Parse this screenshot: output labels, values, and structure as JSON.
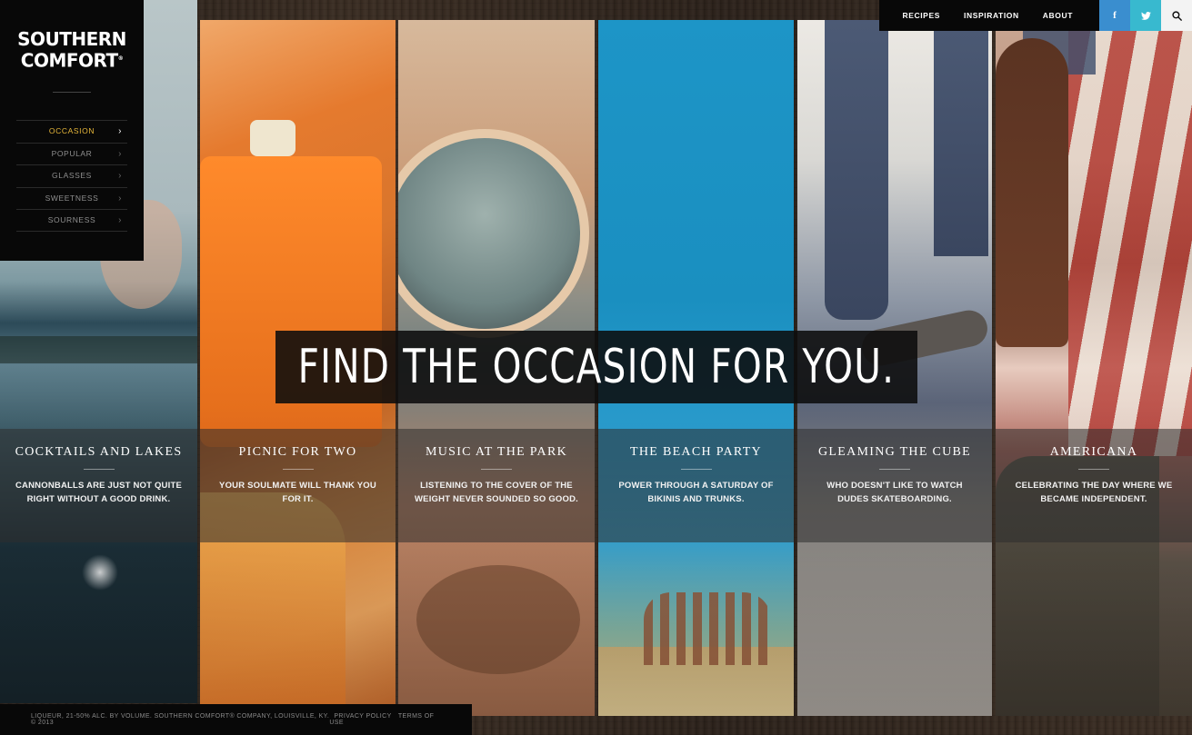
{
  "brand": {
    "line1": "SOUTHERN",
    "line2": "COMFORT",
    "reg": "®"
  },
  "sidebar": {
    "items": [
      {
        "label": "OCCASION",
        "active": true
      },
      {
        "label": "POPULAR",
        "active": false
      },
      {
        "label": "GLASSES",
        "active": false
      },
      {
        "label": "SWEETNESS",
        "active": false
      },
      {
        "label": "SOURNESS",
        "active": false
      }
    ],
    "chevron": "›"
  },
  "topnav": {
    "links": [
      "RECIPES",
      "INSPIRATION",
      "ABOUT"
    ],
    "facebook_icon": "f",
    "twitter_icon": "twitter-bird",
    "search_icon": "magnifier"
  },
  "headline": "FIND THE OCCASION FOR YOU.",
  "occasions": [
    {
      "title": "COCKTAILS AND LAKES",
      "desc": "CANNONBALLS ARE JUST NOT QUITE RIGHT WITHOUT A GOOD DRINK."
    },
    {
      "title": "PICNIC FOR TWO",
      "desc": "YOUR SOULMATE WILL THANK YOU FOR IT."
    },
    {
      "title": "MUSIC AT THE PARK",
      "desc": "LISTENING TO THE COVER OF THE WEIGHT NEVER SOUNDED SO GOOD."
    },
    {
      "title": "THE BEACH PARTY",
      "desc": "POWER THROUGH A SATURDAY OF BIKINIS AND TRUNKS."
    },
    {
      "title": "GLEAMING THE CUBE",
      "desc": "WHO DOESN'T LIKE TO WATCH DUDES SKATEBOARDING."
    },
    {
      "title": "AMERICANA",
      "desc": "CELEBRATING THE DAY WHERE WE BECAME INDEPENDENT."
    }
  ],
  "footer": {
    "legal": "LIQUEUR, 21-50% ALC. BY VOLUME. SOUTHERN COMFORT® COMPANY, LOUISVILLE, KY. © 2013",
    "privacy": "PRIVACY POLICY",
    "terms": "TERMS OF USE"
  },
  "colors": {
    "active_nav": "#e8b83a",
    "facebook": "#3a8ecf",
    "twitter": "#38b9cf"
  }
}
